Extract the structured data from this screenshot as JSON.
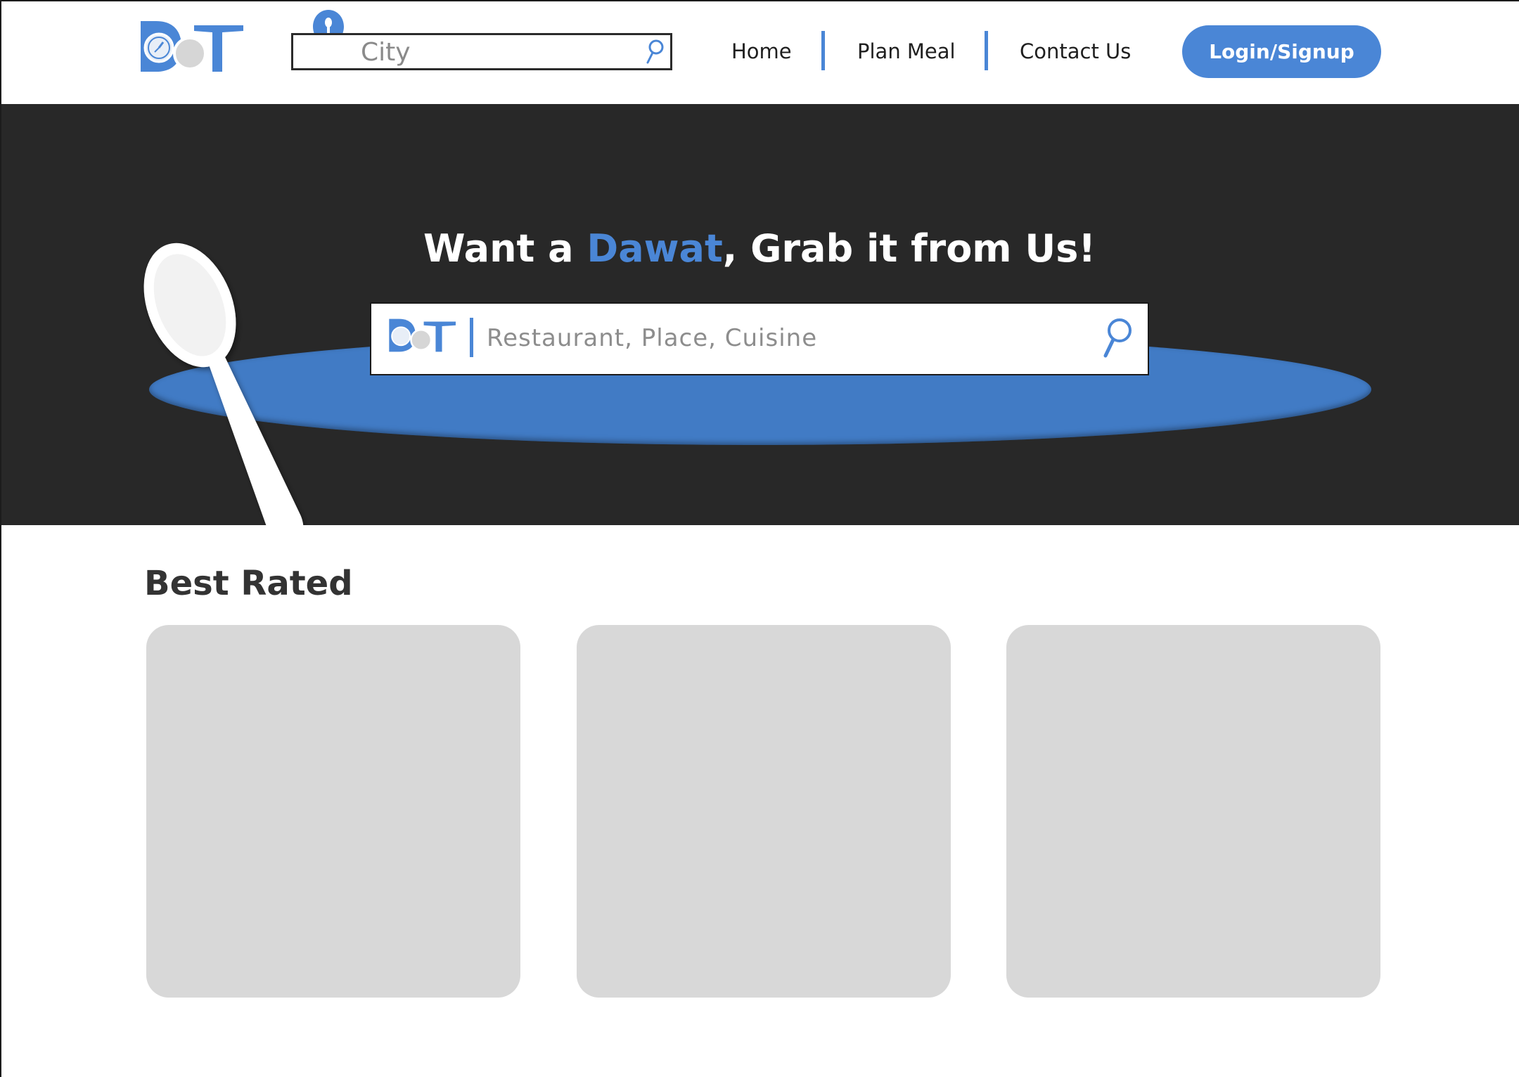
{
  "brand": {
    "logo_text": "DT",
    "accent_color": "#4a86d6"
  },
  "header": {
    "city_placeholder": "City",
    "nav": [
      {
        "label": "Home"
      },
      {
        "label": "Plan Meal"
      },
      {
        "label": "Contact Us"
      }
    ],
    "login_label": "Login/Signup"
  },
  "hero": {
    "title_pre": "Want a ",
    "title_accent": "Dawat",
    "title_post": ", Grab it from Us!",
    "search_placeholder": "Restaurant, Place, Cuisine",
    "background_color": "#282828",
    "plate_color": "#417bc5"
  },
  "best_rated": {
    "title": "Best Rated",
    "cards": [
      {},
      {},
      {}
    ]
  }
}
